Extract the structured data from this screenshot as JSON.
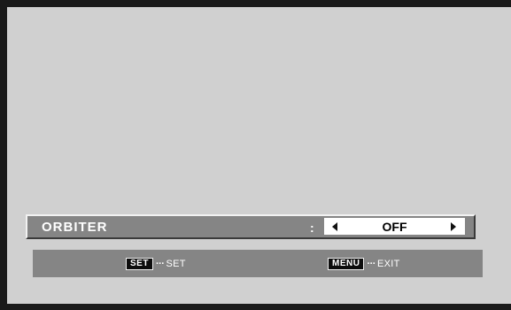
{
  "menu": {
    "label": "ORBITER",
    "separator": ":",
    "value": "OFF"
  },
  "help": {
    "set_key": "SET",
    "set_dots": "···",
    "set_action": "SET",
    "menu_key": "MENU",
    "menu_dots": "···",
    "menu_action": "EXIT"
  },
  "icons": {
    "left": "arrow-left-icon",
    "right": "arrow-right-icon"
  },
  "colors": {
    "frame": "#1a1a1a",
    "background": "#d0d0d0",
    "bar": "#858585",
    "value_box": "#ffffff",
    "text": "#ffffff"
  }
}
